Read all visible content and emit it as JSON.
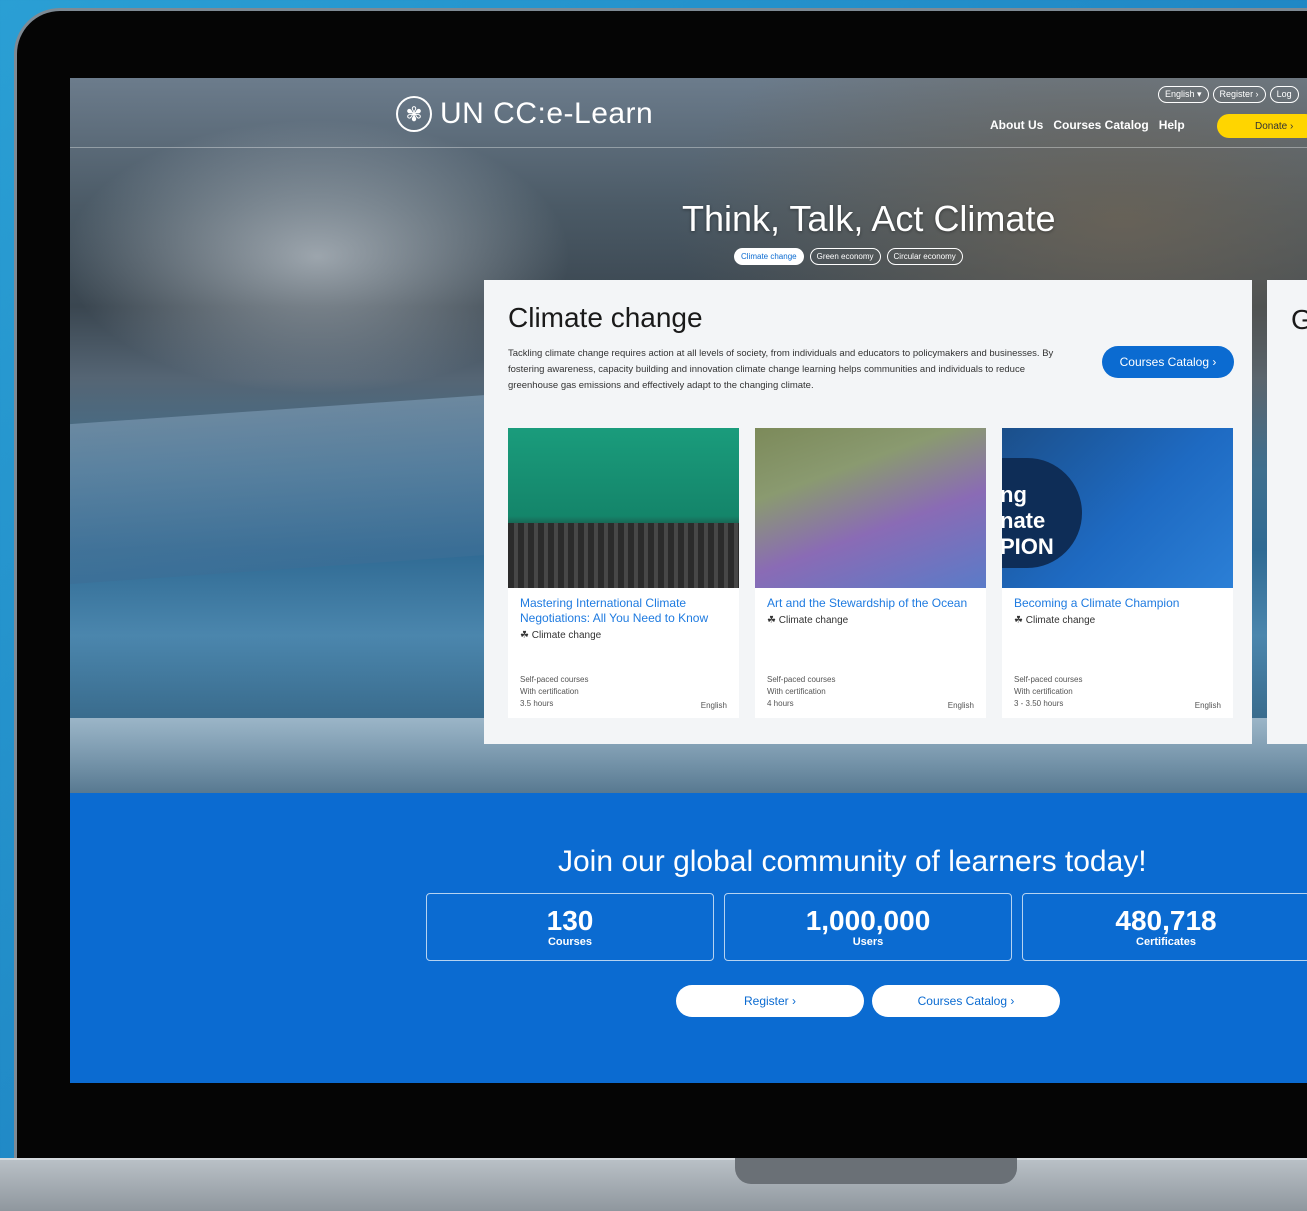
{
  "site": {
    "logo_text": "UN CC:e-Learn",
    "util_links": [
      "English ▾",
      "Register ›",
      "Log"
    ],
    "nav": [
      "About Us",
      "Courses Catalog",
      "Help"
    ],
    "donate_label": "Donate ›"
  },
  "hero": {
    "title": "Think, Talk, Act Climate",
    "tabs": [
      "Climate change",
      "Green economy",
      "Circular economy"
    ],
    "active_tab": "Climate change"
  },
  "topic_card": {
    "title": "Climate change",
    "description": "Tackling climate change requires action at all levels of society, from individuals and educators to policymakers and businesses. By fostering awareness, capacity building and innovation climate change learning helps communities and individuals to reduce greenhouse gas emissions and effectively adapt to the changing climate.",
    "catalog_button": "Courses Catalog ›",
    "courses": [
      {
        "title": "Mastering International Climate Negotiations: All You Need to Know",
        "tag": "Climate change",
        "meta": [
          "Self-paced courses",
          "With certification",
          "3.5 hours"
        ],
        "language": "English"
      },
      {
        "title": "Art and the Stewardship of the Ocean",
        "tag": "Climate change",
        "meta": [
          "Self-paced courses",
          "With certification",
          "4 hours"
        ],
        "language": "English"
      },
      {
        "title": "Becoming a Climate Champion",
        "tag": "Climate change",
        "meta": [
          "Self-paced courses",
          "With certification",
          "3 - 3.50 hours"
        ],
        "language": "English"
      }
    ],
    "thumb_3_text": "ng\nnate\nPION"
  },
  "next_card": {
    "title_initial": "G"
  },
  "community": {
    "title": "Join our global community of learners today!",
    "stats": [
      {
        "value": "130",
        "label": "Courses"
      },
      {
        "value": "1,000,000",
        "label": "Users"
      },
      {
        "value": "480,718",
        "label": "Certificates"
      }
    ],
    "register_button": "Register ›",
    "catalog_button": "Courses Catalog ›"
  },
  "colors": {
    "accent": "#0b6bd1",
    "donate": "#ffd500",
    "link": "#1f7be0"
  }
}
